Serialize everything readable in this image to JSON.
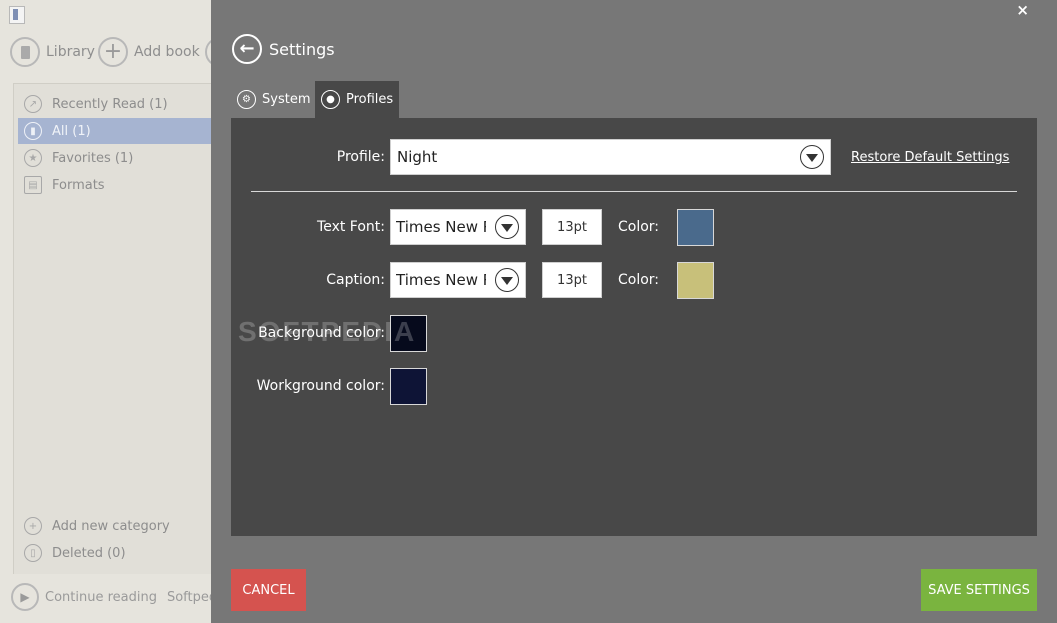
{
  "library": {
    "toolbar": {
      "library_label": "Library",
      "add_book_label": "Add book"
    },
    "nav": [
      {
        "label": "Recently Read (1)",
        "icon": "share-icon"
      },
      {
        "label": "All (1)",
        "icon": "book-icon",
        "selected": true
      },
      {
        "label": "Favorites (1)",
        "icon": "star-icon"
      },
      {
        "label": "Formats",
        "icon": "file-icon"
      }
    ],
    "bottom": [
      {
        "label": "Add new category",
        "icon": "plus-icon"
      },
      {
        "label": "Deleted (0)",
        "icon": "trash-icon"
      }
    ],
    "footer": {
      "continue_label": "Continue reading",
      "status_text": "Softpedia"
    }
  },
  "settings": {
    "title": "Settings",
    "tabs": [
      {
        "label": "System",
        "icon": "gears-icon"
      },
      {
        "label": "Profiles",
        "icon": "user-icon",
        "active": true
      }
    ],
    "profile": {
      "label": "Profile:",
      "value": "Night",
      "restore_label": "Restore Default Settings"
    },
    "text_font": {
      "label": "Text Font:",
      "font": "Times New R",
      "size": "13pt",
      "color_label": "Color:",
      "color": "#4a6a8c"
    },
    "caption": {
      "label": "Caption:",
      "font": "Times New R",
      "size": "13pt",
      "color_label": "Color:",
      "color": "#c8c07a"
    },
    "background": {
      "label": "Background color:",
      "color": "#060a1c"
    },
    "workground": {
      "label": "Workground color:",
      "color": "#0e1436"
    },
    "cancel_label": "CANCEL",
    "save_label": "SAVE SETTINGS",
    "close_glyph": "×"
  },
  "watermark": "SOFTPEDIA",
  "colors": {
    "cancel": "#d5534f",
    "save": "#7ab43f",
    "selection": "#a6b4d1"
  }
}
